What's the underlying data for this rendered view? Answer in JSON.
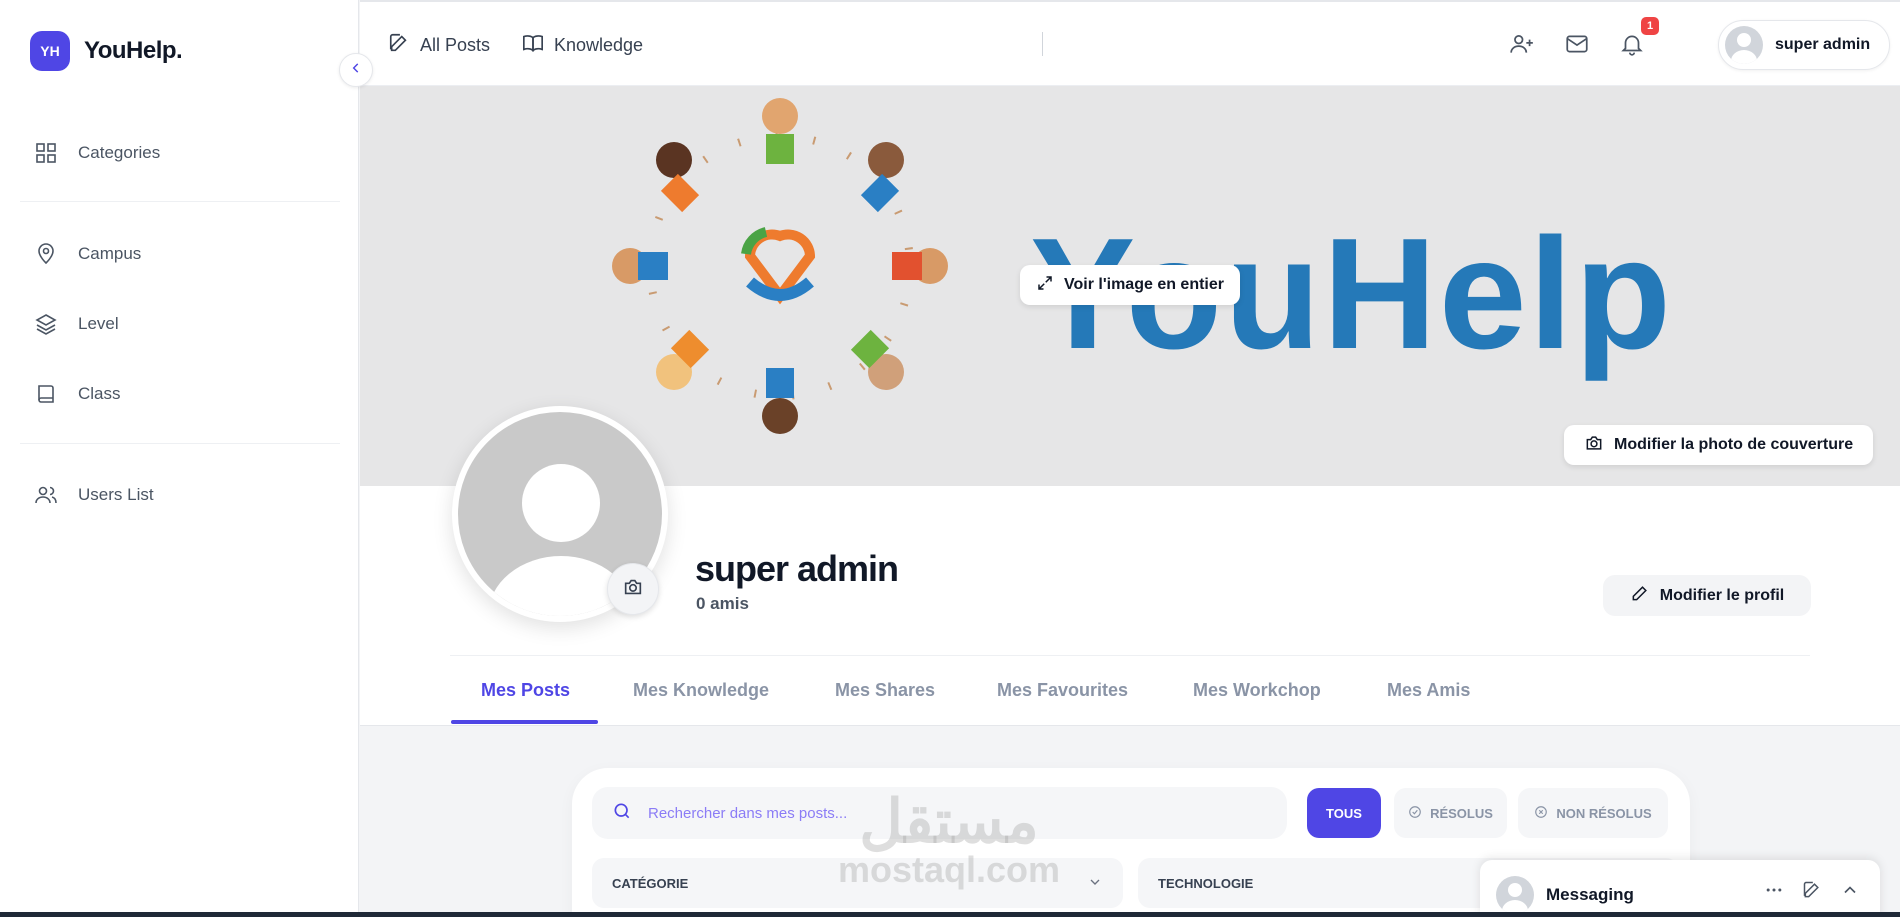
{
  "brand": {
    "badge": "YH",
    "name": "YouHelp."
  },
  "sidebar": {
    "items": [
      {
        "label": "Categories",
        "icon": "grid-icon"
      },
      {
        "label": "Campus",
        "icon": "map-pin-icon"
      },
      {
        "label": "Level",
        "icon": "layers-icon"
      },
      {
        "label": "Class",
        "icon": "book-icon"
      },
      {
        "label": "Users List",
        "icon": "users-icon"
      }
    ]
  },
  "topbar": {
    "all_posts": "All Posts",
    "knowledge": "Knowledge",
    "notification_count": "1",
    "user_name": "super admin"
  },
  "cover": {
    "logo_text": "YouHelp",
    "view_full": "Voir l'image en entier",
    "edit_cover": "Modifier la photo de couverture"
  },
  "profile": {
    "name": "super admin",
    "friends": "0 amis",
    "edit_profile": "Modifier le profil"
  },
  "tabs": [
    {
      "label": "Mes Posts",
      "active": true
    },
    {
      "label": "Mes Knowledge",
      "active": false
    },
    {
      "label": "Mes Shares",
      "active": false
    },
    {
      "label": "Mes Favourites",
      "active": false
    },
    {
      "label": "Mes Workchop",
      "active": false
    },
    {
      "label": "Mes Amis",
      "active": false
    }
  ],
  "filters": {
    "search_placeholder": "Rechercher dans mes posts...",
    "all": "TOUS",
    "resolved": "RÉSOLUS",
    "unresolved": "NON RÉSOLUS",
    "category": "CATÉGORIE",
    "technology": "TECHNOLOGIE"
  },
  "messaging": {
    "label": "Messaging"
  },
  "watermark": {
    "arabic": "مستقل",
    "latin": "mostaql.com"
  },
  "colors": {
    "accent": "#4f46e5",
    "cover_text": "#2579b8",
    "badge": "#ef4444"
  }
}
